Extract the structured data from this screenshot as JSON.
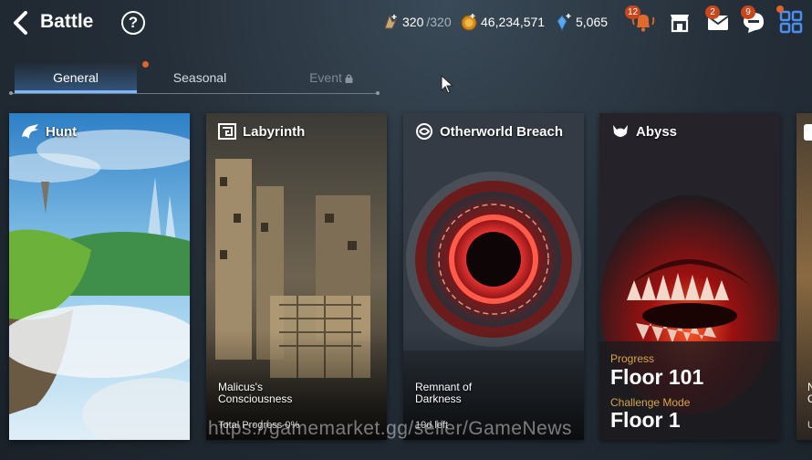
{
  "header": {
    "title": "Battle"
  },
  "resources": {
    "stamina": {
      "value": "320",
      "max": "/320"
    },
    "gold": "46,234,571",
    "crystals": "5,065"
  },
  "badges": {
    "notifications": "12",
    "mail": "2",
    "chat": "9"
  },
  "tabs": [
    {
      "label": "General",
      "active": true
    },
    {
      "label": "Seasonal",
      "active": false
    },
    {
      "label": "Event",
      "locked": true
    }
  ],
  "cards": {
    "hunt": {
      "title": "Hunt"
    },
    "labyrinth": {
      "title": "Labyrinth",
      "subtitle_line1": "Malicus's",
      "subtitle_line2": "Consciousness",
      "note": "Total Progress 0%"
    },
    "breach": {
      "title": "Otherworld Breach",
      "subtitle_line1": "Remnant of",
      "subtitle_line2": "Darkness",
      "note": "19d left"
    },
    "abyss": {
      "title": "Abyss",
      "progress_label": "Progress",
      "progress_value": "Floor 101",
      "challenge_label": "Challenge Mode",
      "challenge_value": "Floor 1"
    },
    "partial": {
      "line1": "N",
      "line2": "C",
      "line3": "U"
    }
  },
  "watermark": "https://gamemarket.gg/seller/GameNews",
  "colors": {
    "accent_tab": "#7fb6ff",
    "badge": "#c8471c",
    "abyss_label": "#d8a64a"
  }
}
